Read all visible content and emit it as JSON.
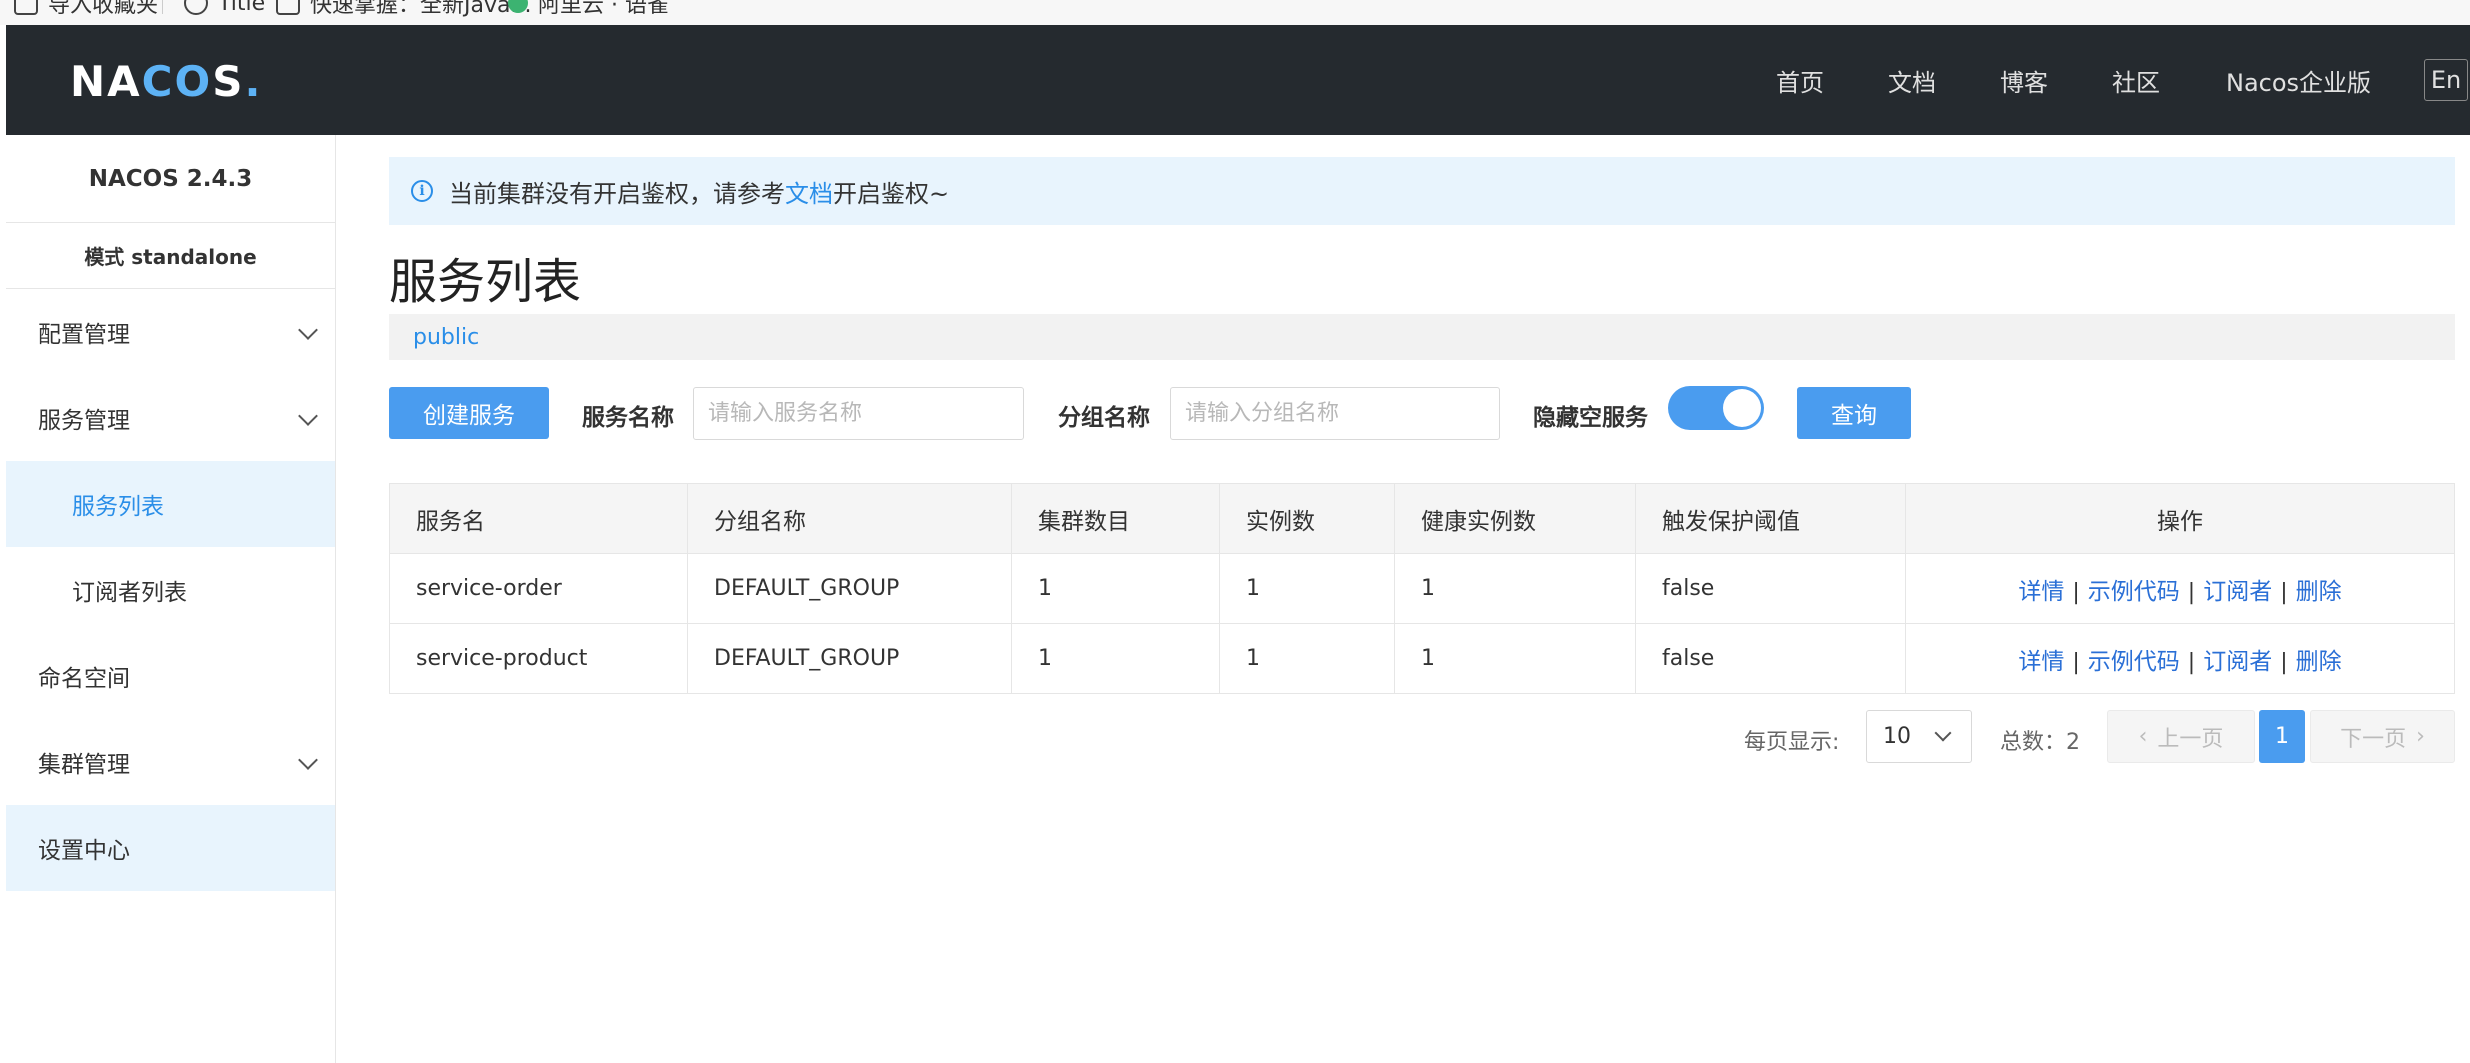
{
  "bookmarks": [
    {
      "label": "导入收藏夹",
      "icon": "folder-icon"
    },
    {
      "label": "Title",
      "icon": "globe-icon"
    },
    {
      "label": "快速掌握：全新Java...",
      "icon": "bookmark-icon"
    },
    {
      "label": "阿里云 · 语雀",
      "icon": "leaf-icon"
    }
  ],
  "header": {
    "logo": {
      "part1": "NA",
      "part2": "CO",
      "part3": "S",
      "dot": "."
    },
    "nav": [
      "首页",
      "文档",
      "博客",
      "社区",
      "Nacos企业版"
    ],
    "lang": "En"
  },
  "sidebar": {
    "version": "NACOS 2.4.3",
    "mode": "模式 standalone",
    "items": [
      {
        "label": "配置管理"
      },
      {
        "label": "服务管理"
      },
      {
        "label": "服务列表"
      },
      {
        "label": "订阅者列表"
      },
      {
        "label": "命名空间"
      },
      {
        "label": "集群管理"
      },
      {
        "label": "设置中心"
      }
    ]
  },
  "notice": {
    "before": "当前集群没有开启鉴权，请参考",
    "link": "文档",
    "after": "开启鉴权~"
  },
  "page": {
    "title": "服务列表",
    "namespace": "public"
  },
  "toolbar": {
    "create_label": "创建服务",
    "service_name_label": "服务名称",
    "service_name_placeholder": "请输入服务名称",
    "group_name_label": "分组名称",
    "group_name_placeholder": "请输入分组名称",
    "hide_empty_label": "隐藏空服务",
    "query_label": "查询"
  },
  "table": {
    "headers": [
      "服务名",
      "分组名称",
      "集群数目",
      "实例数",
      "健康实例数",
      "触发保护阈值",
      "操作"
    ],
    "rows": [
      [
        "service-order",
        "DEFAULT_GROUP",
        "1",
        "1",
        "1",
        "false"
      ],
      [
        "service-product",
        "DEFAULT_GROUP",
        "1",
        "1",
        "1",
        "false"
      ]
    ],
    "ops": {
      "detail": "详情",
      "sample": "示例代码",
      "subscribers": "订阅者",
      "delete": "删除",
      "sep": "|"
    }
  },
  "pagination": {
    "page_size_label": "每页显示:",
    "page_size": "10",
    "total_label": "总数：2",
    "prev": "上一页",
    "next": "下一页",
    "current": "1"
  },
  "colors": {
    "accent": "#4a9cef",
    "header_bg": "#252a2f",
    "link": "#2a6fd6"
  }
}
